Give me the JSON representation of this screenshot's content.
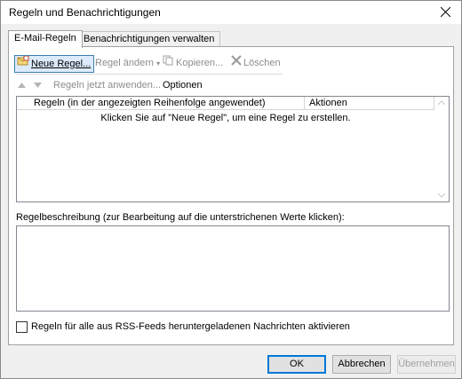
{
  "window": {
    "title": "Regeln und Benachrichtigungen"
  },
  "tabs": [
    {
      "label": "E-Mail-Regeln",
      "active": true
    },
    {
      "label": "Benachrichtigungen verwalten",
      "active": false
    }
  ],
  "toolbar": {
    "new_rule": "Neue Regel...",
    "change_rule": "Regel ändern",
    "copy": "Kopieren...",
    "delete": "Löschen",
    "apply_rules": "Regeln jetzt anwenden...",
    "options": "Optionen"
  },
  "rules_list": {
    "columns": [
      "Regeln (in der angezeigten Reihenfolge angewendet)",
      "Aktionen"
    ],
    "empty_message": "Klicken Sie auf \"Neue Regel\", um eine Regel zu erstellen."
  },
  "description": {
    "label": "Regelbeschreibung (zur Bearbeitung auf die unterstrichenen Werte klicken):"
  },
  "rss_checkbox": {
    "label": "Regeln für alle aus RSS-Feeds heruntergeladenen Nachrichten aktivieren",
    "checked": false
  },
  "buttons": {
    "ok": "OK",
    "cancel": "Abbrechen",
    "apply": "Übernehmen"
  },
  "colors": {
    "accent": "#0078d7",
    "disabled_text": "#8c8c8c"
  }
}
